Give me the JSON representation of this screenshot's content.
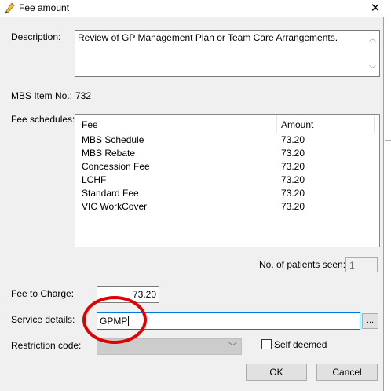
{
  "window": {
    "title": "Fee amount",
    "close_glyph": "✕",
    "title_icon": "pencil-icon"
  },
  "description": {
    "label": "Description:",
    "value": "Review of GP Management Plan or Team Care Arrangements."
  },
  "mbs": {
    "label": "MBS Item No.:",
    "value": "732"
  },
  "fee_schedules": {
    "label": "Fee schedules:",
    "columns": [
      "Fee",
      "Amount"
    ],
    "rows": [
      {
        "fee": "MBS Schedule",
        "amount": "73.20"
      },
      {
        "fee": "MBS Rebate",
        "amount": "73.20"
      },
      {
        "fee": "Concession Fee",
        "amount": "73.20"
      },
      {
        "fee": "LCHF",
        "amount": "73.20"
      },
      {
        "fee": "Standard Fee",
        "amount": "73.20"
      },
      {
        "fee": "VIC WorkCover",
        "amount": "73.20"
      }
    ]
  },
  "patients_seen": {
    "label": "No. of patients seen:",
    "value": "1"
  },
  "fee_to_charge": {
    "label": "Fee to Charge:",
    "value": "73.20"
  },
  "service_details": {
    "label": "Service details:",
    "value": "GPMP",
    "browse_label": "..."
  },
  "restriction_code": {
    "label": "Restriction code:",
    "value": ""
  },
  "self_deemed": {
    "label": "Self deemed",
    "checked": false
  },
  "buttons": {
    "ok": "OK",
    "cancel": "Cancel"
  },
  "colors": {
    "annotation_circle": "#e10000",
    "focus_border": "#0078d7"
  }
}
